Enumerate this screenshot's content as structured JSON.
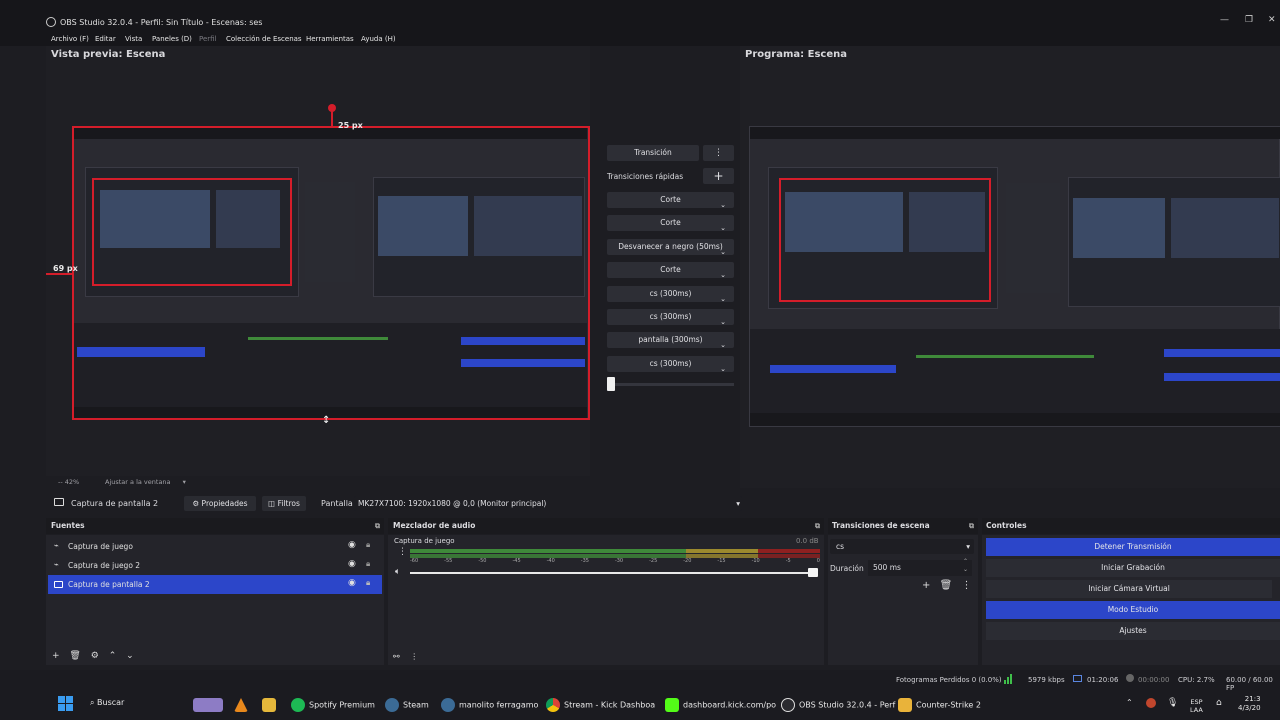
{
  "window": {
    "title": "OBS Studio 32.0.4 - Perfil: Sin Título - Escenas: ses",
    "minimize": "—",
    "maximize": "❐",
    "close": "✕"
  },
  "menu": [
    "Archivo (F)",
    "Editar",
    "Vista",
    "Paneles (D)",
    "Perfil",
    "Colección de Escenas",
    "Herramientas",
    "Ayuda (H)"
  ],
  "preview": {
    "title": "Vista previa: Escena",
    "top_label": "25 px",
    "left_label": "69 px",
    "zoom": "42%",
    "fit": "Ajustar a la ventana"
  },
  "program": {
    "title": "Programa: Escena"
  },
  "transitions_panel": {
    "transition_button": "Transición",
    "quick_label": "Transiciones rápidas",
    "items": [
      "Corte",
      "Corte",
      "Desvanecer a negro (50ms)",
      "Corte",
      "cs (300ms)",
      "cs (300ms)",
      "pantalla (300ms)",
      "cs (300ms)"
    ]
  },
  "source_toolbar": {
    "source_name": "Captura de pantalla 2",
    "properties": "Propiedades",
    "filters": "Filtros",
    "screen_label": "Pantalla",
    "screen_value": "MK27X7100: 1920x1080 @ 0,0 (Monitor principal)"
  },
  "sources": {
    "title": "Fuentes",
    "items": [
      {
        "label": "Captura de juego",
        "selected": false
      },
      {
        "label": "Captura de juego 2",
        "selected": false
      },
      {
        "label": "Captura de pantalla 2",
        "selected": true
      }
    ]
  },
  "mixer": {
    "title": "Mezclador de audio",
    "channel": "Captura de juego",
    "db": "0.0 dB",
    "ticks": [
      "-60",
      "-55",
      "-50",
      "-45",
      "-40",
      "-35",
      "-30",
      "-25",
      "-20",
      "-15",
      "-10",
      "-5",
      "0"
    ]
  },
  "scene_transitions": {
    "title": "Transiciones de escena",
    "selected": "cs",
    "duration_label": "Duración",
    "duration_value": "500 ms"
  },
  "controls": {
    "title": "Controles",
    "buttons": [
      "Detener Transmisión",
      "Iniciar Grabación",
      "Iniciar Cámara Virtual",
      "Modo Estudio",
      "Ajustes"
    ]
  },
  "status": {
    "dropped": "Fotogramas Perdidos 0 (0.0%)",
    "bitrate": "5979 kbps",
    "stream_time": "01:20:06",
    "rec_time": "00:00:00",
    "cpu": "CPU: 2.7%",
    "fps": "60.00 / 60.00 FP"
  },
  "taskbar": {
    "search": "Buscar",
    "apps": [
      "Spotify Premium",
      "Steam",
      "manolito ferragamo",
      "Stream - Kick Dashboa",
      "dashboard.kick.com/po",
      "OBS Studio 32.0.4 - Perf",
      "Counter-Strike 2"
    ],
    "lang_top": "ESP",
    "lang_bottom": "LAA",
    "time": "21:3",
    "date": "4/3/20"
  },
  "colors": {
    "accent_blue": "#2c46c9",
    "red_bounding": "#d41d2a",
    "meter_green": "#3f8a3a",
    "meter_yellow": "#9c8a2e",
    "meter_red": "#8e2020"
  }
}
